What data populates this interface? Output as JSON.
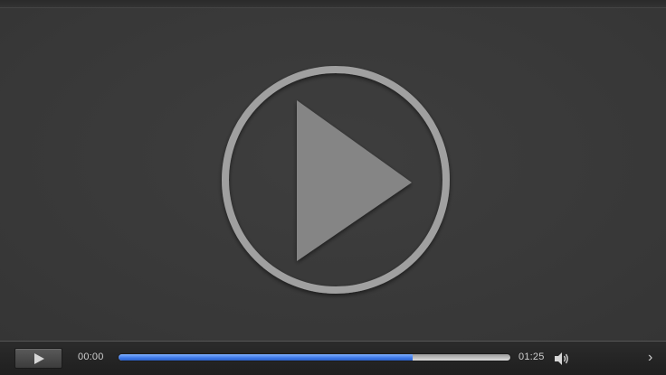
{
  "player": {
    "icons": {
      "big_play": "play-circle-icon",
      "play": "play-icon",
      "volume": "volume-icon",
      "next": "chevron-right-icon"
    },
    "current_time": "00:00",
    "total_time": "01:25",
    "progress_fraction": 0.75,
    "next_glyph": "›",
    "colors": {
      "progress_fill": "#3d78e8",
      "track": "#cccccc",
      "big_play_ring": "#a0a0a0",
      "big_play_triangle": "#858585"
    }
  }
}
